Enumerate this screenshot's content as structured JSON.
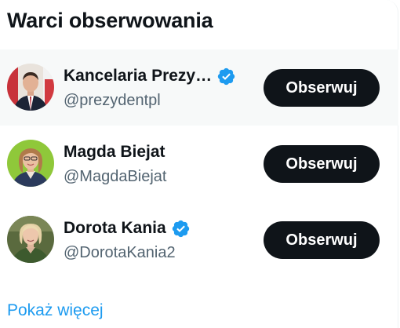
{
  "section": {
    "title": "Warci obserwowania",
    "show_more_label": "Pokaż więcej"
  },
  "colors": {
    "text_primary": "#0f1419",
    "text_secondary": "#536471",
    "accent_link": "#1d9bf0",
    "verified_badge": "#1d9bf0",
    "follow_button_bg": "#0f1419",
    "row_hover_bg": "#f7f9f9"
  },
  "suggestions": [
    {
      "name": "Kancelaria Prezy…",
      "handle": "@prezydentpl",
      "verified": true,
      "follow_label": "Obserwuj",
      "avatar": "man-in-suit-avatar"
    },
    {
      "name": "Magda Biejat",
      "handle": "@MagdaBiejat",
      "verified": false,
      "follow_label": "Obserwuj",
      "avatar": "woman-green-background-avatar"
    },
    {
      "name": "Dorota Kania",
      "handle": "@DorotaKania2",
      "verified": true,
      "follow_label": "Obserwuj",
      "avatar": "woman-blonde-avatar"
    }
  ]
}
